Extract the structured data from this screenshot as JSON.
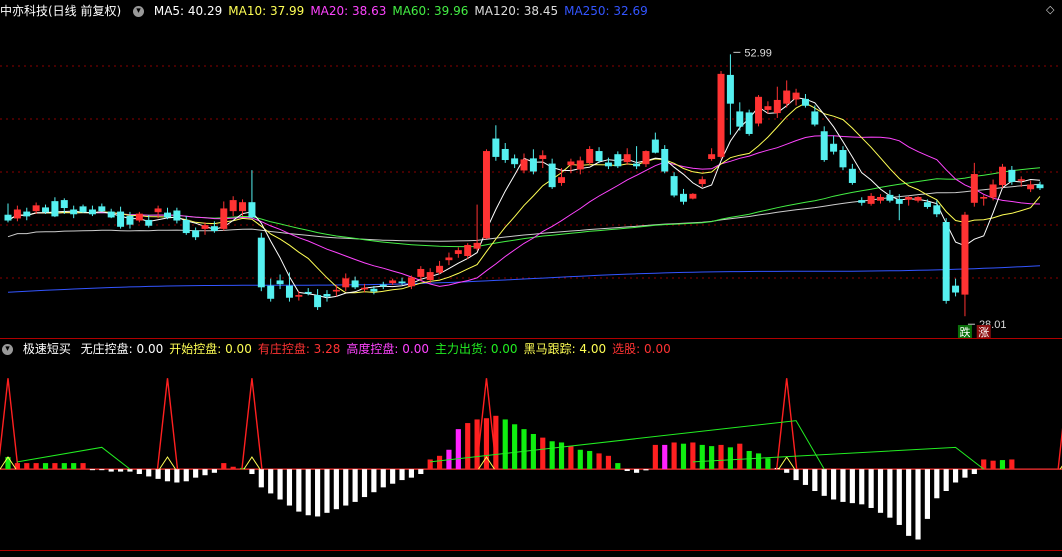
{
  "main_header": {
    "title": "中亦科技(日线 前复权)",
    "indicators": [
      {
        "label": "MA5: 40.29",
        "color": "#ffffff"
      },
      {
        "label": "MA10: 37.99",
        "color": "#ffff55"
      },
      {
        "label": "MA20: 38.63",
        "color": "#ff44ff"
      },
      {
        "label": "MA60: 39.96",
        "color": "#44ee44"
      },
      {
        "label": "MA120: 38.45",
        "color": "#dddddd"
      },
      {
        "label": "MA250: 32.69",
        "color": "#3355ff"
      }
    ]
  },
  "sub_header": {
    "title": "极速短买",
    "indicators": [
      {
        "label": "无庄控盘: 0.00",
        "color": "#ffffff"
      },
      {
        "label": "开始控盘: 0.00",
        "color": "#ffff55"
      },
      {
        "label": "有庄控盘: 3.28",
        "color": "#ff3333"
      },
      {
        "label": "高度控盘: 0.00",
        "color": "#ff44ff"
      },
      {
        "label": "主力出货: 0.00",
        "color": "#22ee22"
      },
      {
        "label": "黑马跟踪: 4.00",
        "color": "#ffff55"
      },
      {
        "label": "选股: 0.00",
        "color": "#ff3333"
      }
    ]
  },
  "annotations": {
    "high_label": "52.99",
    "low_label": "28.01",
    "fall_tag": "跌",
    "rise_tag": "涨"
  },
  "colors": {
    "up": "#ff3333",
    "down": "#55f0f0",
    "grid": "#8b0000",
    "ma5": "#ffffff",
    "ma10": "#ffff55",
    "ma20": "#ff44ff",
    "ma60": "#44ee44",
    "ma120": "#cccccc",
    "ma250": "#3355ff"
  },
  "chart_data": [
    {
      "type": "candlestick",
      "title": "中亦科技(日线 前复权)",
      "ylim": [
        26,
        56
      ],
      "candles": [
        {
          "o": 37.5,
          "h": 38.6,
          "l": 36.8,
          "c": 37.0
        },
        {
          "o": 37.2,
          "h": 38.4,
          "l": 36.9,
          "c": 38.0
        },
        {
          "o": 37.8,
          "h": 38.2,
          "l": 37.0,
          "c": 37.4
        },
        {
          "o": 37.9,
          "h": 38.7,
          "l": 37.6,
          "c": 38.4
        },
        {
          "o": 38.2,
          "h": 38.5,
          "l": 37.6,
          "c": 37.8
        },
        {
          "o": 38.8,
          "h": 39.2,
          "l": 37.3,
          "c": 37.4
        },
        {
          "o": 38.9,
          "h": 39.1,
          "l": 37.6,
          "c": 38.2
        },
        {
          "o": 38.0,
          "h": 38.4,
          "l": 37.2,
          "c": 37.6
        },
        {
          "o": 38.3,
          "h": 38.5,
          "l": 37.7,
          "c": 37.8
        },
        {
          "o": 38.0,
          "h": 38.4,
          "l": 37.4,
          "c": 37.6
        },
        {
          "o": 38.3,
          "h": 38.6,
          "l": 37.8,
          "c": 37.9
        },
        {
          "o": 37.8,
          "h": 38.1,
          "l": 37.2,
          "c": 37.3
        },
        {
          "o": 37.8,
          "h": 38.3,
          "l": 36.2,
          "c": 36.4
        },
        {
          "o": 37.4,
          "h": 37.8,
          "l": 36.2,
          "c": 36.6
        },
        {
          "o": 37.0,
          "h": 37.8,
          "l": 36.8,
          "c": 37.6
        },
        {
          "o": 37.0,
          "h": 37.5,
          "l": 36.3,
          "c": 36.5
        },
        {
          "o": 37.8,
          "h": 38.4,
          "l": 37.2,
          "c": 38.1
        },
        {
          "o": 37.7,
          "h": 38.2,
          "l": 37.1,
          "c": 37.3
        },
        {
          "o": 37.9,
          "h": 38.2,
          "l": 36.7,
          "c": 37.0
        },
        {
          "o": 37.0,
          "h": 37.4,
          "l": 35.6,
          "c": 35.8
        },
        {
          "o": 36.0,
          "h": 36.3,
          "l": 35.1,
          "c": 35.4
        },
        {
          "o": 36.2,
          "h": 36.8,
          "l": 35.6,
          "c": 36.5
        },
        {
          "o": 36.4,
          "h": 36.9,
          "l": 35.8,
          "c": 36.0
        },
        {
          "o": 36.2,
          "h": 38.8,
          "l": 36.0,
          "c": 38.1
        },
        {
          "o": 37.9,
          "h": 39.3,
          "l": 37.4,
          "c": 38.9
        },
        {
          "o": 37.9,
          "h": 39.0,
          "l": 37.4,
          "c": 38.7
        },
        {
          "o": 38.7,
          "h": 41.8,
          "l": 37.2,
          "c": 37.3
        },
        {
          "o": 35.3,
          "h": 35.8,
          "l": 30.2,
          "c": 30.6
        },
        {
          "o": 30.7,
          "h": 31.4,
          "l": 29.2,
          "c": 29.5
        },
        {
          "o": 31.2,
          "h": 31.8,
          "l": 30.4,
          "c": 30.9
        },
        {
          "o": 30.7,
          "h": 32.0,
          "l": 29.2,
          "c": 29.6
        },
        {
          "o": 29.7,
          "h": 30.2,
          "l": 29.3,
          "c": 29.8
        },
        {
          "o": 30.1,
          "h": 30.5,
          "l": 29.8,
          "c": 30.0
        },
        {
          "o": 29.8,
          "h": 30.4,
          "l": 28.4,
          "c": 28.7
        },
        {
          "o": 29.9,
          "h": 30.3,
          "l": 29.2,
          "c": 29.7
        },
        {
          "o": 30.2,
          "h": 30.8,
          "l": 29.7,
          "c": 30.3
        },
        {
          "o": 30.6,
          "h": 31.9,
          "l": 30.2,
          "c": 31.4
        },
        {
          "o": 31.2,
          "h": 31.6,
          "l": 30.4,
          "c": 30.6
        },
        {
          "o": 30.4,
          "h": 30.9,
          "l": 30.1,
          "c": 30.5
        },
        {
          "o": 30.4,
          "h": 30.7,
          "l": 29.9,
          "c": 30.2
        },
        {
          "o": 30.8,
          "h": 31.1,
          "l": 30.4,
          "c": 30.7
        },
        {
          "o": 31.0,
          "h": 31.4,
          "l": 30.8,
          "c": 31.2
        },
        {
          "o": 31.1,
          "h": 31.5,
          "l": 30.8,
          "c": 31.0
        },
        {
          "o": 30.7,
          "h": 31.7,
          "l": 30.4,
          "c": 31.5
        },
        {
          "o": 31.6,
          "h": 32.6,
          "l": 31.2,
          "c": 32.3
        },
        {
          "o": 31.3,
          "h": 32.4,
          "l": 31.0,
          "c": 32.0
        },
        {
          "o": 32.0,
          "h": 33.1,
          "l": 31.8,
          "c": 32.6
        },
        {
          "o": 33.2,
          "h": 33.9,
          "l": 32.7,
          "c": 33.4
        },
        {
          "o": 33.8,
          "h": 34.4,
          "l": 33.4,
          "c": 34.1
        },
        {
          "o": 33.6,
          "h": 34.8,
          "l": 33.3,
          "c": 34.6
        },
        {
          "o": 34.3,
          "h": 38.5,
          "l": 34.1,
          "c": 34.8
        },
        {
          "o": 35.3,
          "h": 43.8,
          "l": 35.2,
          "c": 43.6
        },
        {
          "o": 44.8,
          "h": 46.1,
          "l": 42.7,
          "c": 43.1
        },
        {
          "o": 43.8,
          "h": 44.4,
          "l": 42.5,
          "c": 42.8
        },
        {
          "o": 42.9,
          "h": 43.3,
          "l": 42.0,
          "c": 42.4
        },
        {
          "o": 41.8,
          "h": 43.4,
          "l": 41.5,
          "c": 42.8
        },
        {
          "o": 42.9,
          "h": 43.8,
          "l": 41.4,
          "c": 41.7
        },
        {
          "o": 42.9,
          "h": 43.7,
          "l": 42.0,
          "c": 43.2
        },
        {
          "o": 42.4,
          "h": 42.9,
          "l": 40.0,
          "c": 40.2
        },
        {
          "o": 40.6,
          "h": 42.0,
          "l": 40.3,
          "c": 41.1
        },
        {
          "o": 42.3,
          "h": 42.9,
          "l": 41.5,
          "c": 42.6
        },
        {
          "o": 41.9,
          "h": 43.1,
          "l": 41.4,
          "c": 42.7
        },
        {
          "o": 42.5,
          "h": 44.1,
          "l": 42.3,
          "c": 43.8
        },
        {
          "o": 43.6,
          "h": 44.0,
          "l": 42.5,
          "c": 42.7
        },
        {
          "o": 42.5,
          "h": 43.0,
          "l": 41.9,
          "c": 42.2
        },
        {
          "o": 43.3,
          "h": 43.6,
          "l": 42.0,
          "c": 42.2
        },
        {
          "o": 42.6,
          "h": 43.9,
          "l": 42.3,
          "c": 43.3
        },
        {
          "o": 42.4,
          "h": 44.1,
          "l": 41.9,
          "c": 42.2
        },
        {
          "o": 42.4,
          "h": 43.7,
          "l": 42.1,
          "c": 43.6
        },
        {
          "o": 44.7,
          "h": 45.4,
          "l": 43.4,
          "c": 43.5
        },
        {
          "o": 43.8,
          "h": 44.2,
          "l": 41.5,
          "c": 41.7
        },
        {
          "o": 41.2,
          "h": 41.6,
          "l": 39.2,
          "c": 39.4
        },
        {
          "o": 39.5,
          "h": 40.0,
          "l": 38.5,
          "c": 38.8
        },
        {
          "o": 39.1,
          "h": 39.6,
          "l": 39.0,
          "c": 39.5
        },
        {
          "o": 40.5,
          "h": 41.2,
          "l": 40.2,
          "c": 40.9
        },
        {
          "o": 42.9,
          "h": 43.9,
          "l": 42.7,
          "c": 43.3
        },
        {
          "o": 43.1,
          "h": 51.3,
          "l": 42.9,
          "c": 51.0
        },
        {
          "o": 50.9,
          "h": 52.9,
          "l": 45.2,
          "c": 48.2
        },
        {
          "o": 47.4,
          "h": 48.3,
          "l": 45.6,
          "c": 46.0
        },
        {
          "o": 47.3,
          "h": 47.6,
          "l": 45.1,
          "c": 45.3
        },
        {
          "o": 46.3,
          "h": 49.0,
          "l": 46.0,
          "c": 48.8
        },
        {
          "o": 47.6,
          "h": 48.4,
          "l": 47.2,
          "c": 47.9
        },
        {
          "o": 47.3,
          "h": 49.8,
          "l": 46.8,
          "c": 48.5
        },
        {
          "o": 48.2,
          "h": 50.4,
          "l": 47.8,
          "c": 49.4
        },
        {
          "o": 48.6,
          "h": 49.6,
          "l": 48.0,
          "c": 49.2
        },
        {
          "o": 48.6,
          "h": 49.1,
          "l": 47.8,
          "c": 48.0
        },
        {
          "o": 47.4,
          "h": 48.0,
          "l": 46.0,
          "c": 46.2
        },
        {
          "o": 45.5,
          "h": 46.0,
          "l": 42.6,
          "c": 42.8
        },
        {
          "o": 44.3,
          "h": 45.1,
          "l": 43.3,
          "c": 43.6
        },
        {
          "o": 43.7,
          "h": 44.1,
          "l": 41.8,
          "c": 42.1
        },
        {
          "o": 41.9,
          "h": 42.4,
          "l": 40.4,
          "c": 40.6
        },
        {
          "o": 38.9,
          "h": 39.2,
          "l": 38.4,
          "c": 38.7
        },
        {
          "o": 38.6,
          "h": 39.6,
          "l": 38.4,
          "c": 39.3
        },
        {
          "o": 38.9,
          "h": 39.5,
          "l": 38.6,
          "c": 39.2
        },
        {
          "o": 39.4,
          "h": 39.9,
          "l": 38.7,
          "c": 38.9
        },
        {
          "o": 39.0,
          "h": 39.5,
          "l": 37.0,
          "c": 38.6
        },
        {
          "o": 39.0,
          "h": 39.3,
          "l": 38.4,
          "c": 39.2
        },
        {
          "o": 38.9,
          "h": 39.3,
          "l": 38.7,
          "c": 39.2
        },
        {
          "o": 38.7,
          "h": 39.0,
          "l": 38.1,
          "c": 38.3
        },
        {
          "o": 38.4,
          "h": 38.9,
          "l": 37.3,
          "c": 37.6
        },
        {
          "o": 36.8,
          "h": 37.2,
          "l": 29.0,
          "c": 29.3
        },
        {
          "o": 30.7,
          "h": 31.4,
          "l": 29.7,
          "c": 30.1
        },
        {
          "o": 29.9,
          "h": 37.8,
          "l": 27.8,
          "c": 37.5
        },
        {
          "o": 38.7,
          "h": 42.5,
          "l": 38.3,
          "c": 41.4
        },
        {
          "o": 39.1,
          "h": 39.4,
          "l": 38.4,
          "c": 39.2
        },
        {
          "o": 39.2,
          "h": 40.9,
          "l": 38.9,
          "c": 40.4
        },
        {
          "o": 40.4,
          "h": 42.4,
          "l": 40.1,
          "c": 42.1
        },
        {
          "o": 41.8,
          "h": 42.2,
          "l": 40.4,
          "c": 40.7
        },
        {
          "o": 40.9,
          "h": 41.2,
          "l": 40.2,
          "c": 40.9
        },
        {
          "o": 40.0,
          "h": 40.8,
          "l": 39.7,
          "c": 40.4
        },
        {
          "o": 40.4,
          "h": 40.7,
          "l": 39.9,
          "c": 40.1
        }
      ]
    },
    {
      "type": "bar",
      "title": "极速短买",
      "ylim": [
        -13,
        18
      ],
      "values": [
        2,
        1,
        1,
        1,
        1,
        1,
        1,
        1,
        1,
        0,
        0,
        -0.4,
        -0.4,
        -0.4,
        -0.8,
        -1.2,
        -1.6,
        -2,
        -2.2,
        -2,
        -1.4,
        -1,
        -0.6,
        1,
        0.4,
        0.2,
        -0.8,
        -3,
        -4,
        -5,
        -6,
        -7,
        -7.6,
        -7.8,
        -7.2,
        -6.6,
        -6,
        -5.4,
        -4.6,
        -3.8,
        -3,
        -2.4,
        -1.8,
        -1.4,
        -0.8,
        1.6,
        2.2,
        3.2,
        6.6,
        7.6,
        8.2,
        8.4,
        8.8,
        8.2,
        7.4,
        6.6,
        5.8,
        5.2,
        4.6,
        4.4,
        3.8,
        3.2,
        3,
        2.6,
        2.2,
        1,
        -0.3,
        -0.6,
        -0.2,
        4,
        4,
        4.4,
        4.2,
        4.4,
        4,
        3.8,
        4,
        3.6,
        4.2,
        3,
        2.6,
        1.8,
        0.2,
        -0.6,
        -1.8,
        -2.6,
        -3.6,
        -4.4,
        -5,
        -5.4,
        -5.6,
        -5.8,
        -6.4,
        -7.2,
        -8,
        -9.2,
        -11,
        -11.6,
        -8.2,
        -4.8,
        -3.6,
        -2.2,
        -1.4,
        -0.8,
        1.6,
        1.4,
        1.5,
        1.6
      ],
      "colors": [
        "g",
        "r",
        "r",
        "r",
        "g",
        "r",
        "g",
        "g",
        "r",
        "w",
        "w",
        "w",
        "w",
        "w",
        "w",
        "w",
        "w",
        "w",
        "w",
        "w",
        "w",
        "w",
        "w",
        "r",
        "r",
        "g",
        "w",
        "w",
        "w",
        "w",
        "w",
        "w",
        "w",
        "w",
        "w",
        "w",
        "w",
        "w",
        "w",
        "w",
        "w",
        "w",
        "w",
        "w",
        "w",
        "r",
        "r",
        "m",
        "m",
        "r",
        "r",
        "r",
        "r",
        "g",
        "g",
        "g",
        "g",
        "r",
        "g",
        "g",
        "r",
        "g",
        "g",
        "r",
        "r",
        "g",
        "w",
        "w",
        "w",
        "r",
        "m",
        "r",
        "g",
        "r",
        "g",
        "g",
        "r",
        "g",
        "r",
        "g",
        "g",
        "g",
        "w",
        "w",
        "w",
        "w",
        "w",
        "w",
        "w",
        "w",
        "w",
        "w",
        "w",
        "w",
        "w",
        "w",
        "w",
        "w",
        "w",
        "w",
        "w",
        "w",
        "w",
        "w",
        "r",
        "r",
        "g",
        "r"
      ],
      "spike_indices": [
        0,
        17,
        26,
        51,
        83,
        113
      ],
      "spike_level": 15,
      "black_horse_level": 4
    }
  ]
}
